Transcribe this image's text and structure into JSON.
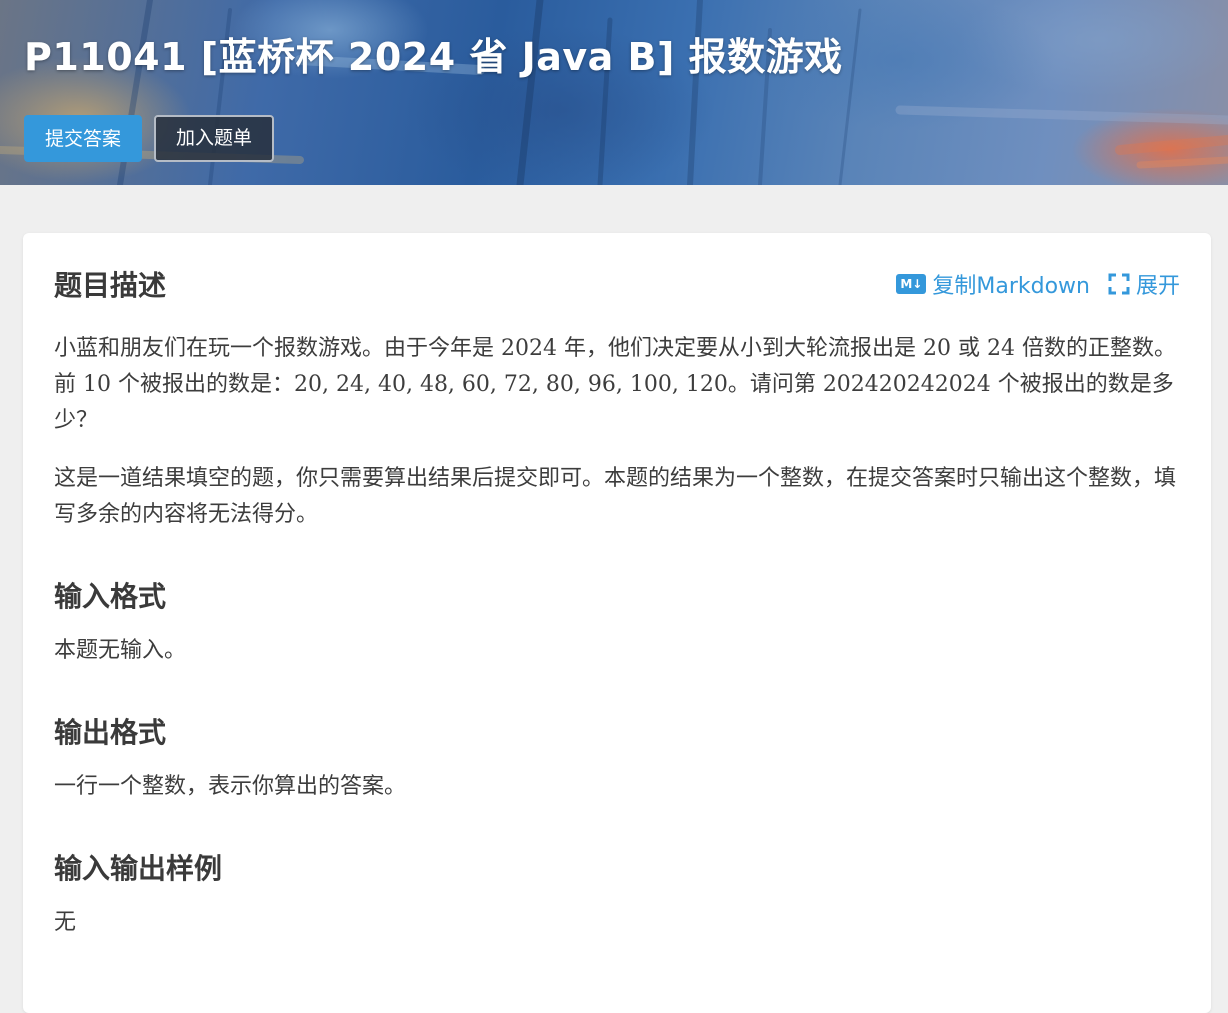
{
  "problem": {
    "title": "P11041 [蓝桥杯 2024 省 Java B] 报数游戏",
    "submit_label": "提交答案",
    "add_list_label": "加入题单"
  },
  "description": {
    "heading": "题目描述",
    "copy_markdown_label": "复制Markdown",
    "md_icon_text": "M↓",
    "expand_label": "展开",
    "p1": {
      "t1": "小蓝和朋友们在玩一个报数游戏。由于今年是 ",
      "m1": "2024",
      "t2": " 年，他们决定要从小到大轮流报出是 ",
      "m2": "20",
      "t3": " 或 ",
      "m3": "24",
      "t4": " 倍数的正整数。前 ",
      "m4": "10",
      "t5": " 个被报出的数是：",
      "m5": "20, 24, 40, 48, 60, 72, 80, 96, 100, 120",
      "t6": "。请问第 ",
      "m6": "202420242024",
      "t7": " 个被报出的数是多少？"
    },
    "p2": "这是一道结果填空的题，你只需要算出结果后提交即可。本题的结果为一个整数，在提交答案时只输出这个整数，填写多余的内容将无法得分。"
  },
  "input_format": {
    "heading": "输入格式",
    "text": "本题无输入。"
  },
  "output_format": {
    "heading": "输出格式",
    "text": "一行一个整数，表示你算出的答案。"
  },
  "samples": {
    "heading": "输入输出样例",
    "text": "无"
  },
  "colors": {
    "accent": "#3498db",
    "background": "#efefef",
    "card": "#ffffff",
    "text": "#3d3d3d"
  }
}
